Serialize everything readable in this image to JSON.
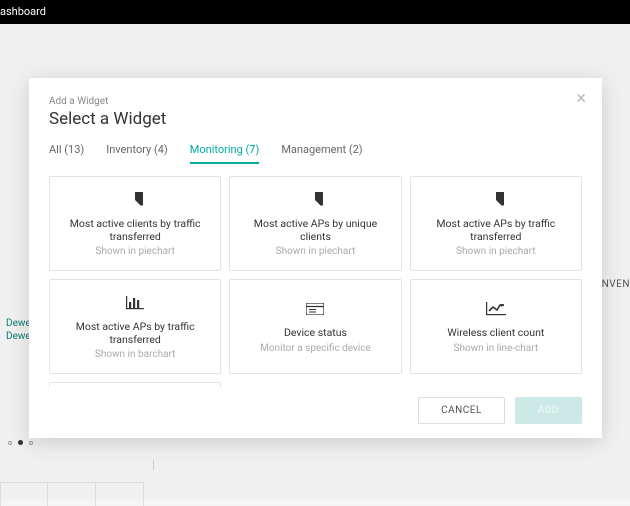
{
  "topbar": {
    "title": "ashboard"
  },
  "background": {
    "side_items": [
      "Dewe)",
      "Dewey"
    ],
    "right_label": "INVEN"
  },
  "modal": {
    "breadcrumb": "Add a Widget",
    "title": "Select a Widget",
    "close_glyph": "×",
    "tabs": [
      {
        "label": "All (13)",
        "active": false
      },
      {
        "label": "Inventory (4)",
        "active": false
      },
      {
        "label": "Monitoring (7)",
        "active": true
      },
      {
        "label": "Management (2)",
        "active": false
      }
    ],
    "cards": [
      {
        "icon": "pie",
        "title": "Most active clients by traffic transferred",
        "sub": "Shown in piechart"
      },
      {
        "icon": "pie",
        "title": "Most active APs by unique clients",
        "sub": "Shown in piechart"
      },
      {
        "icon": "pie",
        "title": "Most active APs by traffic transferred",
        "sub": "Shown in piechart"
      },
      {
        "icon": "bar",
        "title": "Most active APs by traffic transferred",
        "sub": "Shown in barchart"
      },
      {
        "icon": "device",
        "title": "Device status",
        "sub": "Monitor a specific device"
      },
      {
        "icon": "line",
        "title": "Wireless client count",
        "sub": "Shown in line-chart"
      }
    ],
    "buttons": {
      "cancel": "CANCEL",
      "add": "ADD"
    }
  }
}
